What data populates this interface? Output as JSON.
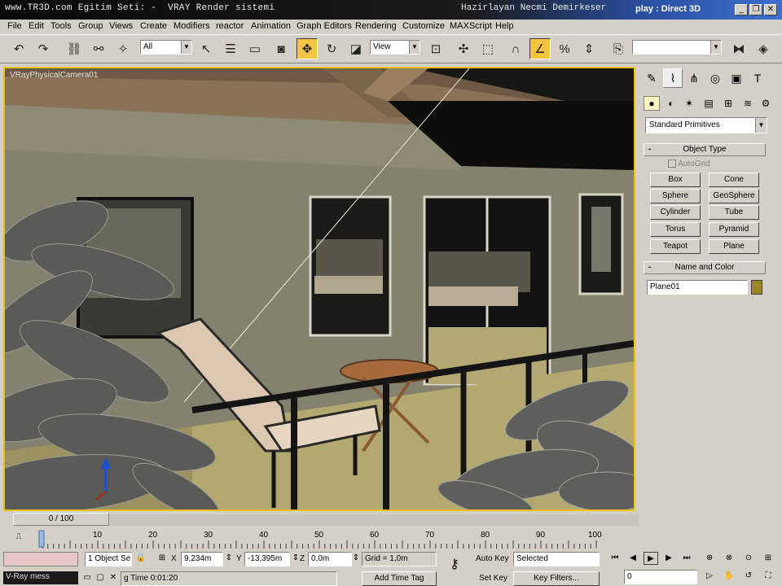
{
  "title": {
    "left": "www.TR3D.com Egitim Seti: -  VRAY Render sistemi",
    "right": "Hazirlayan Necmi Demirkeser",
    "display": "play : Direct 3D",
    "minimize": "_",
    "restore": "❐",
    "close": "✕"
  },
  "menu": [
    "File",
    "Edit",
    "Tools",
    "Group",
    "Views",
    "Create",
    "Modifiers",
    "reactor",
    "Animation",
    "Graph Editors",
    "Rendering",
    "Customize",
    "MAXScript",
    "Help"
  ],
  "toolbar": {
    "selection_filter": "All",
    "ref_coord": "View",
    "named_selection": ""
  },
  "viewport": {
    "label": "VRayPhysicalCamera01"
  },
  "command_panel": {
    "category": "Standard Primitives",
    "object_type_title": "Object Type",
    "autogrid": "AutoGrid",
    "buttons": [
      "Box",
      "Cone",
      "Sphere",
      "GeoSphere",
      "Cylinder",
      "Tube",
      "Torus",
      "Pyramid",
      "Teapot",
      "Plane"
    ],
    "name_color_title": "Name and Color",
    "object_name": "Plane01",
    "object_color": "#9a8420"
  },
  "time": {
    "frame_display": "0 / 100",
    "ticks": [
      "10",
      "20",
      "30",
      "40",
      "50",
      "60",
      "70",
      "80",
      "90",
      "100"
    ],
    "start": "0",
    "end": "100"
  },
  "status": {
    "selection": "1 Object Se",
    "x_label": "X",
    "x_value": "9,234m",
    "y_label": "Y",
    "y_value": "-13,395m",
    "z_label": "Z",
    "z_value": "0,0m",
    "grid": "Grid = 1,0m",
    "auto_key": "Auto Key",
    "selected": "Selected",
    "set_key": "Set Key",
    "key_filters": "Key Filters...",
    "add_time_tag": "Add Time Tag",
    "time_prompt": "g Time 0:01:20",
    "current_frame": "0",
    "vray_msg": "V-Ray mess"
  }
}
